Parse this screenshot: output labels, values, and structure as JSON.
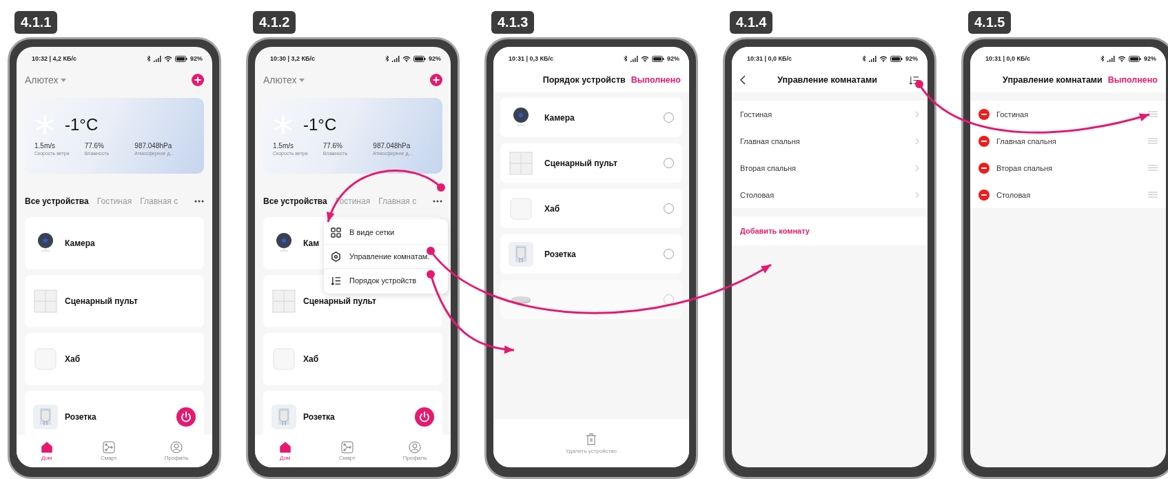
{
  "steps": [
    {
      "label": "4.1.1",
      "status": {
        "time": "10:32 | 4,2 КБ/с",
        "battery": "92%"
      },
      "home": "Алютех",
      "weather": {
        "temperature": "-1°C",
        "stats": [
          {
            "value": "1.5m/s",
            "label": "Скорость ветра"
          },
          {
            "value": "77.6%",
            "label": "Влажность"
          },
          {
            "value": "987.048hPa",
            "label": "Атмосферное д..."
          }
        ]
      },
      "tabs": [
        {
          "label": "Все устройства",
          "selected": true
        },
        {
          "label": "Гостиная",
          "selected": false
        },
        {
          "label": "Главная с",
          "selected": false
        }
      ],
      "devices": [
        {
          "kind": "camera",
          "name": "Камера"
        },
        {
          "kind": "switch",
          "name": "Сценарный пульт"
        },
        {
          "kind": "hub",
          "name": "Хаб"
        },
        {
          "kind": "socket",
          "name": "Розетка"
        }
      ],
      "nav": [
        {
          "kind": "home",
          "label": "Дом",
          "selected": true
        },
        {
          "kind": "smart",
          "label": "Смарт",
          "selected": false
        },
        {
          "kind": "profile",
          "label": "Профиль",
          "selected": false
        }
      ]
    },
    {
      "label": "4.1.2",
      "status": {
        "time": "10:30 | 3,2 КБ/с",
        "battery": "92%"
      },
      "home": "Алютех",
      "weather": {
        "temperature": "-1°C",
        "stats": [
          {
            "value": "1.5m/s",
            "label": "Скорость ветра"
          },
          {
            "value": "77.6%",
            "label": "Влажность"
          },
          {
            "value": "987.048hPa",
            "label": "Атмосферное д..."
          }
        ]
      },
      "tabs": [
        {
          "label": "Все устройства",
          "selected": true
        },
        {
          "label": "Гостиная",
          "selected": false
        },
        {
          "label": "Главная с",
          "selected": false
        }
      ],
      "devices": [
        {
          "kind": "camera",
          "name": "Кам"
        },
        {
          "kind": "switch",
          "name": "Сценарный пульт"
        },
        {
          "kind": "hub",
          "name": "Хаб"
        },
        {
          "kind": "socket",
          "name": "Розетка"
        }
      ],
      "menu": [
        {
          "kind": "grid",
          "label": "В виде сетки"
        },
        {
          "kind": "rooms",
          "label": "Управление комнатам."
        },
        {
          "kind": "sort",
          "label": "Порядок устройств"
        }
      ],
      "nav": [
        {
          "kind": "home",
          "label": "Дом",
          "selected": true
        },
        {
          "kind": "smart",
          "label": "Смарт",
          "selected": false
        },
        {
          "kind": "profile",
          "label": "Профиль",
          "selected": false
        }
      ]
    },
    {
      "label": "4.1.3",
      "status": {
        "time": "10:31 | 0,3 КБ/с",
        "battery": "92%"
      },
      "title": "Порядок устройств",
      "done": "Выполнено",
      "devices": [
        {
          "kind": "camera",
          "name": "Камера",
          "selected": false,
          "faded": false
        },
        {
          "kind": "switch",
          "name": "Сценарный пульт",
          "selected": false,
          "faded": false
        },
        {
          "kind": "hub",
          "name": "Хаб",
          "selected": false,
          "faded": false
        },
        {
          "kind": "socket",
          "name": "Розетка",
          "selected": false,
          "faded": false
        },
        {
          "kind": "puck",
          "selected": false,
          "faded": true
        }
      ],
      "delete": {
        "label": "Удалить устройство",
        "disabled": true
      }
    },
    {
      "label": "4.1.4",
      "status": {
        "time": "10:31 | 0,0 КБ/с",
        "battery": "92%"
      },
      "title": "Управление комнатами",
      "rooms": [
        "Гостиная",
        "Главная спальня",
        "Вторая спальня",
        "Столовая"
      ],
      "add": "Добавить комнату"
    },
    {
      "label": "4.1.5",
      "status": {
        "time": "10:31 | 0,0 КБ/с",
        "battery": "92%"
      },
      "title": "Управление комнатами",
      "done": "Выполнено",
      "rooms": [
        "Гостиная",
        "Главная спальня",
        "Вторая спальня",
        "Столовая"
      ]
    }
  ]
}
